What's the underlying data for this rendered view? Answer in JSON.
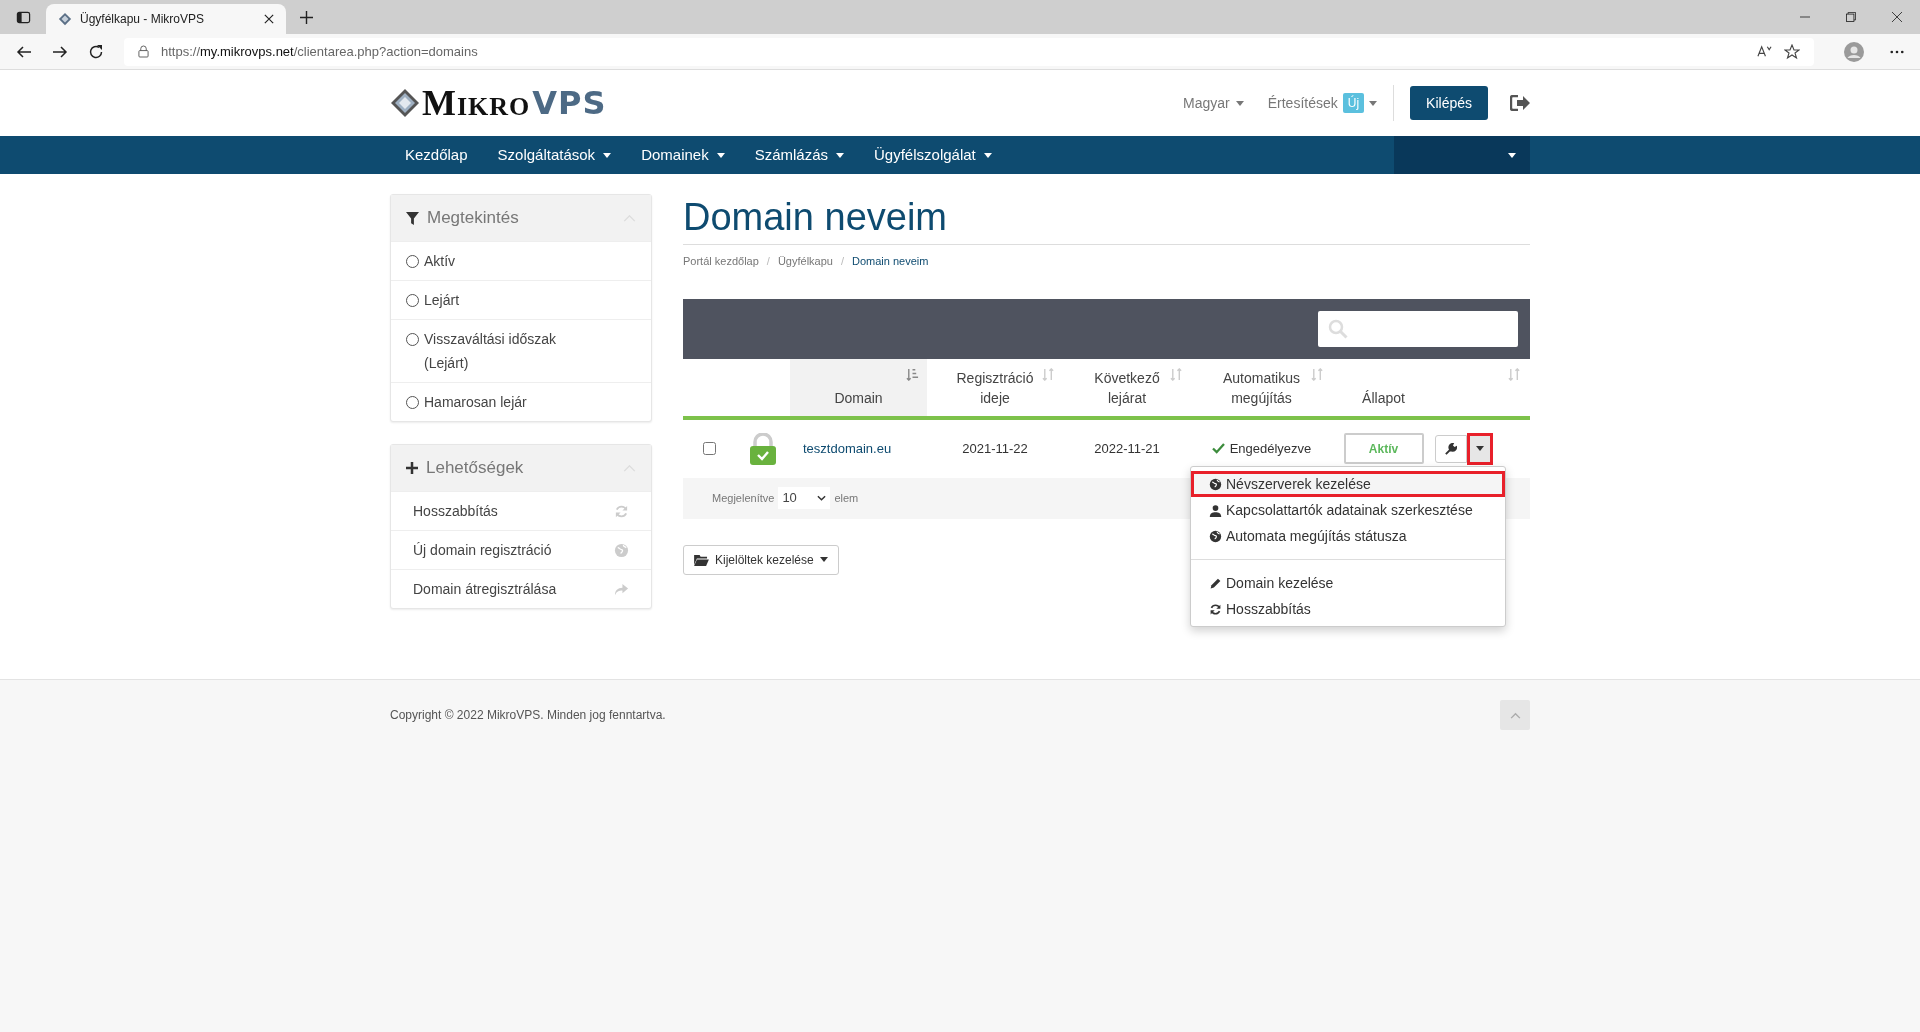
{
  "browser": {
    "tab_title": "Ügyfélkapu - MikroVPS",
    "url": {
      "scheme": "https://",
      "host": "my.mikrovps.net",
      "path": "/clientarea.php?action=domains"
    }
  },
  "header": {
    "logo": {
      "part_1": "MIKRO",
      "part_2": "VPS"
    },
    "language": "Magyar",
    "notifications": {
      "label": "Értesítések",
      "badge": "Új"
    },
    "logout_button": "Kilépés"
  },
  "nav": {
    "items": [
      {
        "label": "Kezdőlap",
        "dropdown": false
      },
      {
        "label": "Szolgáltatások",
        "dropdown": true
      },
      {
        "label": "Domainek",
        "dropdown": true
      },
      {
        "label": "Számlázás",
        "dropdown": true
      },
      {
        "label": "Ügyfélszolgálat",
        "dropdown": true
      }
    ]
  },
  "sidebar": {
    "panels": [
      {
        "title": "Megtekintés",
        "kind": "filter",
        "items": [
          {
            "label": "Aktív",
            "selected": false
          },
          {
            "label": "Lejárt",
            "selected": false
          },
          {
            "label": "Visszaváltási időszak (Lejárt)",
            "selected": false
          },
          {
            "label": "Hamarosan lejár",
            "selected": false
          }
        ]
      },
      {
        "title": "Lehetőségek",
        "kind": "links",
        "items": [
          {
            "label": "Hosszabbítás",
            "kind": "refresh"
          },
          {
            "label": "Új domain regisztráció",
            "kind": "globe"
          },
          {
            "label": "Domain átregisztrálása",
            "kind": "share"
          }
        ]
      }
    ]
  },
  "main": {
    "title": "Domain neveim",
    "breadcrumbs": [
      {
        "label": "Portál kezdőlap",
        "active": false,
        "separator": "/"
      },
      {
        "label": "Ügyfélkapu",
        "active": false,
        "separator": "/"
      },
      {
        "label": "Domain neveim",
        "active": true
      }
    ],
    "table": {
      "columns": [
        {
          "label": "Domain",
          "sortable": true,
          "sorted": true
        },
        {
          "label": "Regisztráció ideje",
          "sortable": true,
          "sorted": false
        },
        {
          "label": "Következő lejárat",
          "sortable": true,
          "sorted": false
        },
        {
          "label": "Automatikus megújítás",
          "sortable": true,
          "sorted": false
        },
        {
          "label": "Állapot",
          "sortable": false
        },
        {
          "sortable": true,
          "sorted": false
        }
      ],
      "rows": [
        {
          "checked": false,
          "domain": "tesztdomain.eu",
          "registered": "2021-11-22",
          "next_expiry": "2022-11-21",
          "auto_renew": "Engedélyezve",
          "status": "Aktív",
          "caret_highlighted": true
        }
      ],
      "pager": {
        "prefix": "Megjelenítve",
        "value": "10",
        "suffix": "elem"
      }
    },
    "bulk_button": "Kijelöltek kezelése",
    "menu": {
      "groups": [
        [
          {
            "label": "Névszerverek kezelése",
            "kind": "globe",
            "highlighted": true
          },
          {
            "label": "Kapcsolattartók adatainak szerkesztése",
            "kind": "user",
            "highlighted": false
          },
          {
            "label": "Automata megújítás státusza",
            "kind": "globe",
            "highlighted": false
          }
        ],
        [
          {
            "label": "Domain kezelése",
            "kind": "pencil",
            "highlighted": false
          },
          {
            "label": "Hosszabbítás",
            "kind": "refresh",
            "highlighted": false
          }
        ]
      ]
    }
  },
  "footer": {
    "copyright": "Copyright © 2022 MikroVPS. Minden jog fenntartva."
  }
}
